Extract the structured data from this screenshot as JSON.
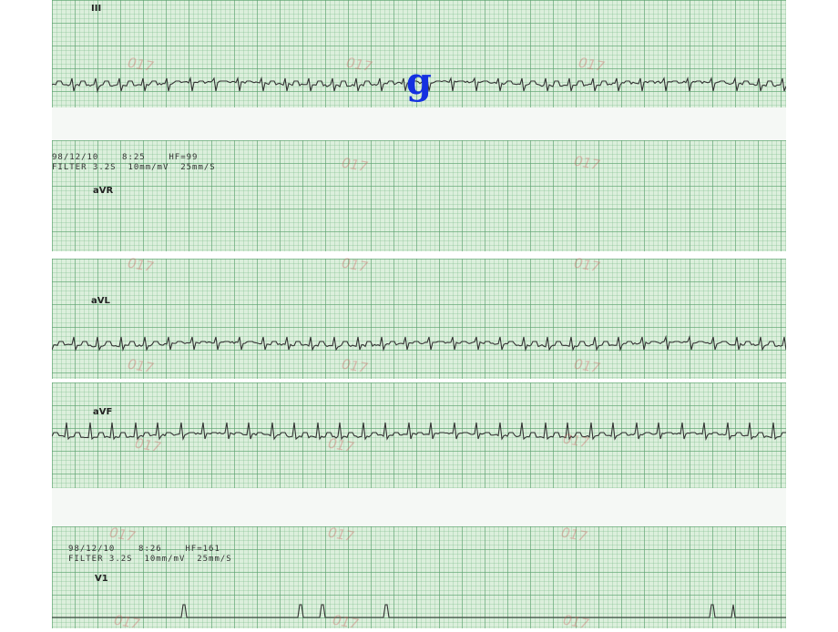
{
  "panel_letter": "g",
  "strips": [
    {
      "lead": "III",
      "header": ""
    },
    {
      "lead": "aVR",
      "header": "98/12/10    8:25    HF=99\nFILTER 3.2S  10mm/mV  25mm/S"
    },
    {
      "lead": "aVL",
      "header": ""
    },
    {
      "lead": "aVF",
      "header": ""
    },
    {
      "lead": "V1",
      "header": "98/12/10    8:26    HF=161\nFILTER 3.2S  10mm/mV  25mm/S"
    }
  ],
  "watermark_text": "017"
}
